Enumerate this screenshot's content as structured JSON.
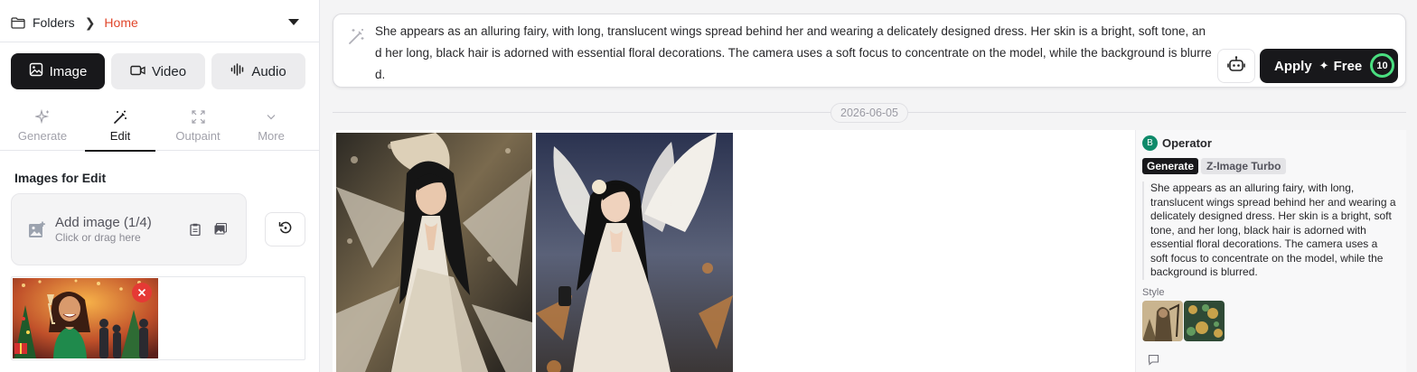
{
  "breadcrumb": {
    "root": "Folders",
    "current": "Home"
  },
  "media_tabs": [
    {
      "label": "Image",
      "icon": "image-icon",
      "active": true
    },
    {
      "label": "Video",
      "icon": "video-icon",
      "active": false
    },
    {
      "label": "Audio",
      "icon": "audio-wave-icon",
      "active": false
    }
  ],
  "tool_tabs": [
    {
      "label": "Generate",
      "icon": "sparkle-icon",
      "active": false
    },
    {
      "label": "Edit",
      "icon": "magic-wand-icon",
      "active": true
    },
    {
      "label": "Outpaint",
      "icon": "expand-icon",
      "active": false
    },
    {
      "label": "More",
      "icon": "chevron-down-icon",
      "active": false
    }
  ],
  "edit_panel": {
    "section_title": "Images for Edit",
    "add_image_label": "Add image (1/4)",
    "add_image_hint": "Click or drag here"
  },
  "prompt": {
    "text": "She appears as an alluring fairy, with long, translucent wings spread behind her and wearing a delicately designed dress. Her skin is a bright, soft tone, and her long, black hair is adorned with essential floral decorations. The camera uses a soft focus to concentrate on the model, while the background is blurred.",
    "apply_label": "Apply",
    "free_label": "Free",
    "credits": "10"
  },
  "feed": {
    "date": "2026-06-05",
    "result": {
      "avatar_letter": "B",
      "operator": "Operator",
      "mode_badge": "Generate",
      "model_badge": "Z-Image Turbo",
      "prompt": "She appears as an alluring fairy, with long, translucent wings spread behind her and wearing a delicately designed dress. Her skin is a bright, soft tone, and her long, black hair is adorned with essential floral decorations. The camera uses a soft focus to concentrate on the model, while the background is blurred.",
      "style_label": "Style"
    }
  },
  "colors": {
    "accent_dark": "#18181b",
    "breadcrumb_active": "#e0452a",
    "credit_ring": "#4ade80",
    "remove_badge": "#e53935",
    "avatar": "#0f8a6a"
  }
}
